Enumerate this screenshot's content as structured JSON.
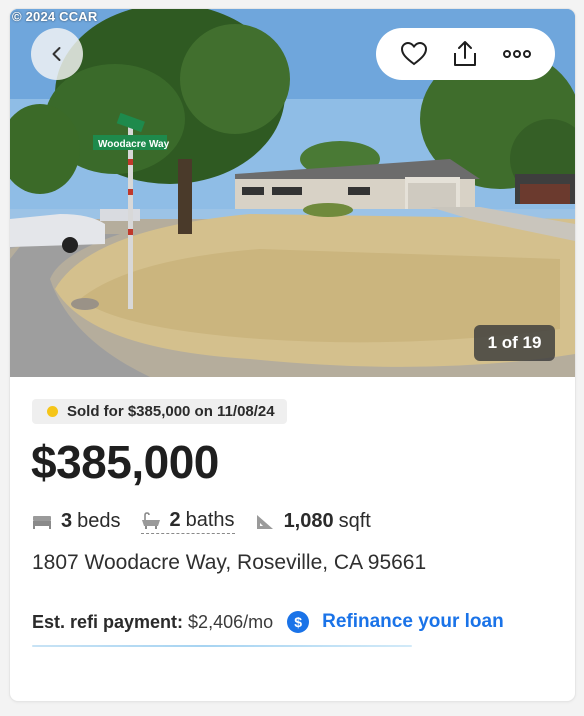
{
  "photo": {
    "copyright": "© 2024 CCAR",
    "street_sign": "Woodacre Way",
    "counter": "1 of 19",
    "icons": {
      "back": "chevron-left-icon",
      "favorite": "heart-icon",
      "share": "share-icon",
      "more": "more-dots-icon"
    }
  },
  "listing": {
    "sold_text": "Sold for $385,000 on 11/08/24",
    "sold_dot_color": "#f5c518",
    "price": "$385,000",
    "beds_num": "3",
    "beds_label": "beds",
    "baths_num": "2",
    "baths_label": "baths",
    "sqft_num": "1,080",
    "sqft_label": "sqft",
    "address": "1807 Woodacre Way, Roseville, CA 95661"
  },
  "refi": {
    "label": "Est. refi payment:",
    "amount": "$2,406/mo",
    "icon_text": "$",
    "link": "Refinance your loan",
    "accent": "#1a73e8"
  }
}
